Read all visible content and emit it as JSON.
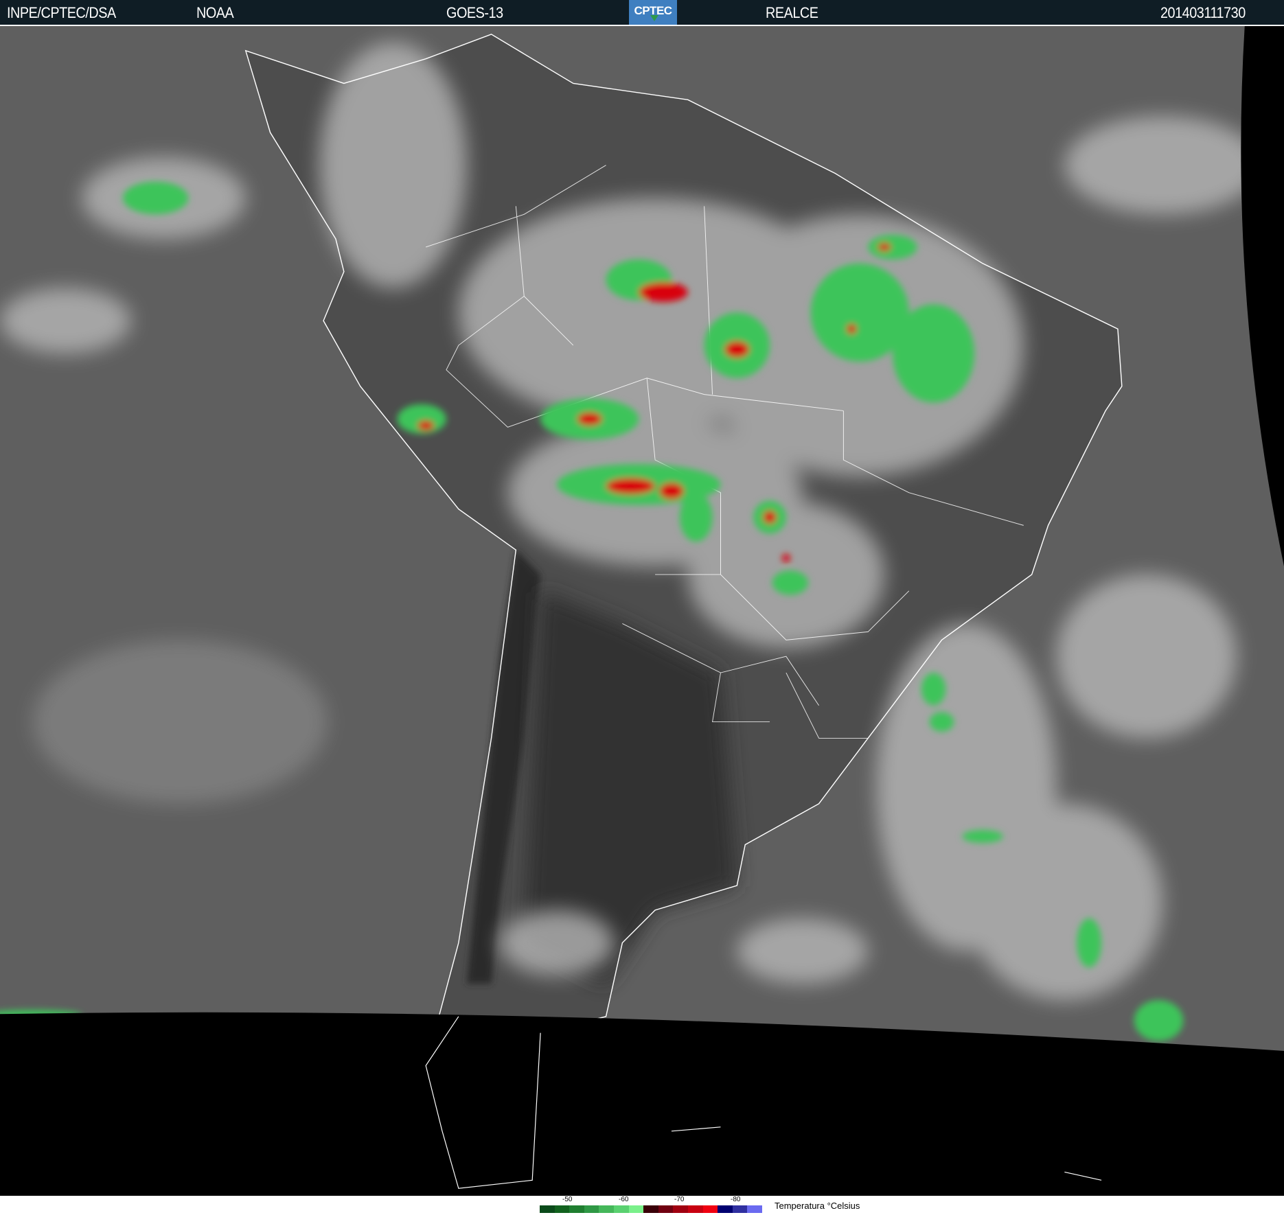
{
  "header": {
    "source": "INPE/CPTEC/DSA",
    "agency": "NOAA",
    "satellite": "GOES-13",
    "logo_text": "CPTEC",
    "product": "REALCE",
    "timestamp": "201403111730"
  },
  "legend": {
    "title": "Temperatura °Celsius",
    "ticks": [
      "-50",
      "-60",
      "-70",
      "-80"
    ],
    "colors": [
      "#0a4a1a",
      "#12621f",
      "#1f7e30",
      "#2f9845",
      "#45b75a",
      "#5ad170",
      "#7af08a",
      "#3a0008",
      "#700010",
      "#a00010",
      "#c80010",
      "#f00010",
      "#000070",
      "#3030a0",
      "#6a6af0"
    ]
  }
}
